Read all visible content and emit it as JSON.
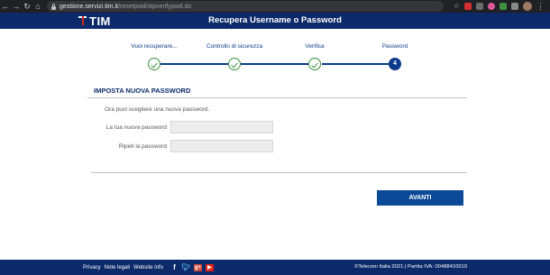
{
  "browser": {
    "url_host": "gestione.servizi.tim.it",
    "url_path": "/resetpwd/otpverifypwd.do",
    "icons": [
      "back-icon",
      "forward-icon",
      "reload-icon",
      "home-icon",
      "lock-icon",
      "star-icon",
      "extension-icon",
      "profile-avatar",
      "menu-icon"
    ]
  },
  "header": {
    "logo": "TIM",
    "title": "Recupera Username o Password"
  },
  "stepper": {
    "steps": [
      {
        "label": "Vuoi recuperare...",
        "state": "done"
      },
      {
        "label": "Controllo di sicurezza",
        "state": "done"
      },
      {
        "label": "Verifica",
        "state": "done"
      },
      {
        "label": "Password",
        "state": "current",
        "number": "4"
      }
    ]
  },
  "form": {
    "section_title": "IMPOSTA NUOVA PASSWORD",
    "intro": "Ora puoi scegliere una nuova password.",
    "new_password_label": "La tua nuova password",
    "new_password_value": "",
    "repeat_password_label": "Ripeti la password",
    "repeat_password_value": "",
    "submit_label": "AVANTI"
  },
  "footer": {
    "links": [
      "Privacy",
      "Note legali",
      "Website info"
    ],
    "social_icons": [
      "facebook-icon",
      "twitter-icon",
      "google-plus-icon",
      "youtube-icon"
    ],
    "legal": "©Telecom Italia 2021 | Partita IVA: 00488410010"
  },
  "colors": {
    "brand_navy": "#0c2a6a",
    "step_blue": "#0c3a8a",
    "check_green": "#3c8f3c",
    "button_blue": "#0c4a99"
  }
}
